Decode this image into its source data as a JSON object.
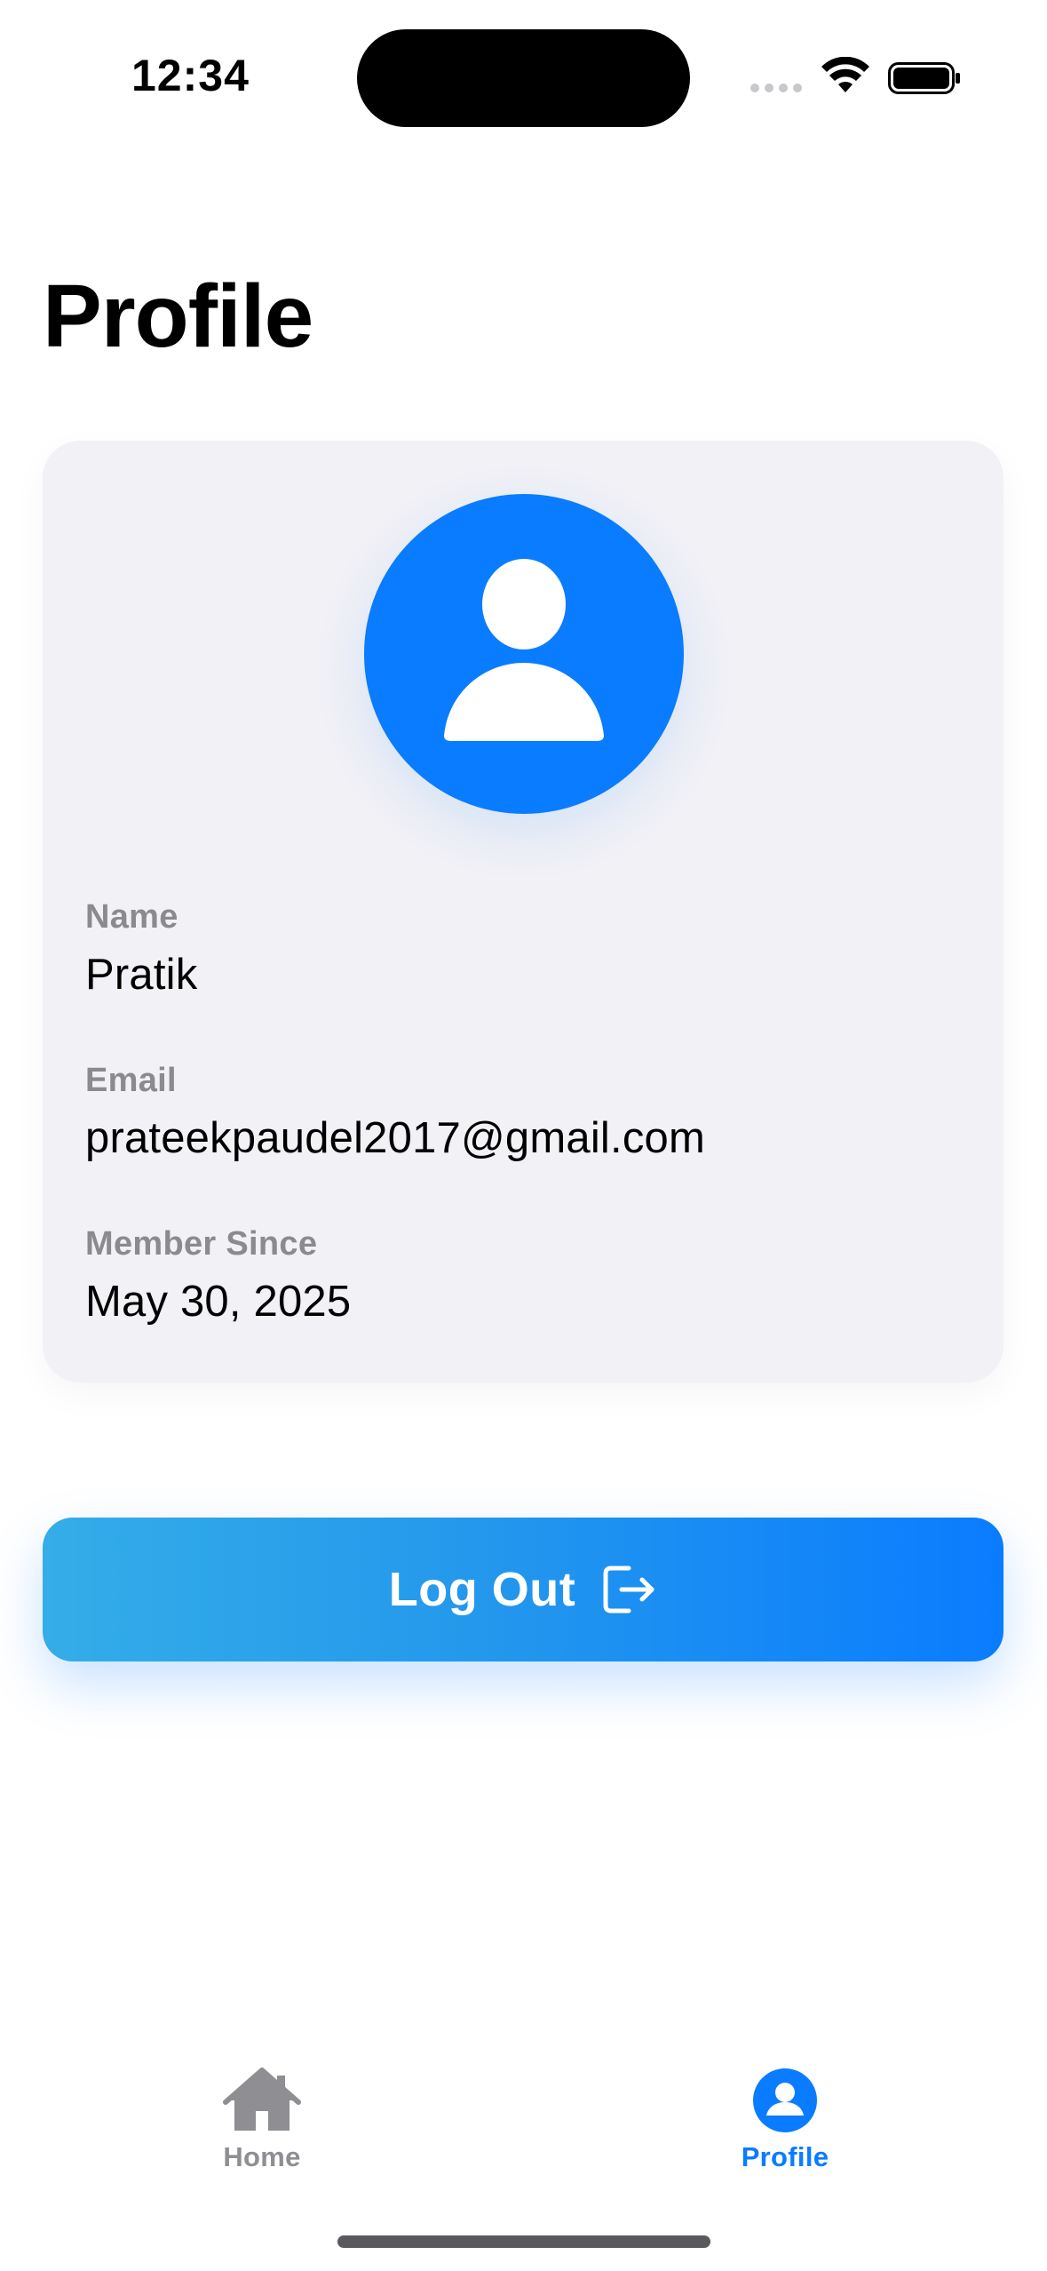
{
  "status_bar": {
    "time": "12:34"
  },
  "page": {
    "title": "Profile"
  },
  "profile": {
    "fields": {
      "name": {
        "label": "Name",
        "value": "Pratik"
      },
      "email": {
        "label": "Email",
        "value": "prateekpaudel2017@gmail.com"
      },
      "member_since": {
        "label": "Member Since",
        "value": "May 30, 2025"
      }
    }
  },
  "actions": {
    "logout_label": "Log Out"
  },
  "tab_bar": {
    "home_label": "Home",
    "profile_label": "Profile",
    "active_tab": "Profile"
  },
  "colors": {
    "accent": "#0a7cff",
    "gradient_start": "#34ade8",
    "card_background": "#f1f1f6",
    "secondary_text": "#8a8a8f",
    "inactive_tab": "#8e8e93"
  },
  "icons": {
    "status": [
      "wifi-icon",
      "battery-icon"
    ],
    "avatar": "person-icon",
    "logout": "logout-icon",
    "tabs": [
      "house-icon",
      "person-circle-icon"
    ]
  }
}
